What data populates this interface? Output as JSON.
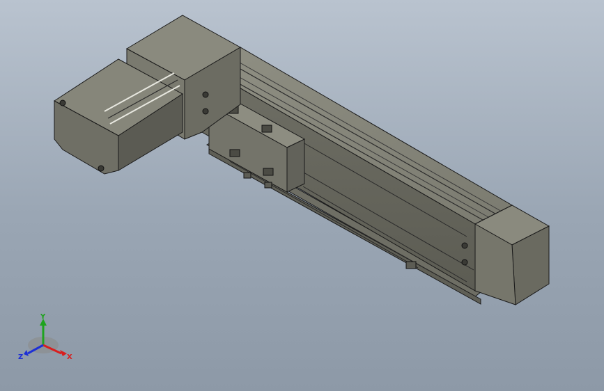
{
  "viewport": {
    "model": {
      "parts": [
        "motor",
        "coupling-housing",
        "linear-rail-body",
        "slide-carriage",
        "end-cap",
        "guide-rail"
      ]
    },
    "triad": {
      "x_label": "X",
      "y_label": "Y",
      "z_label": "Z",
      "colors": {
        "x": "#d81e1e",
        "y": "#1fa31f",
        "z": "#1d2fd6"
      }
    }
  }
}
